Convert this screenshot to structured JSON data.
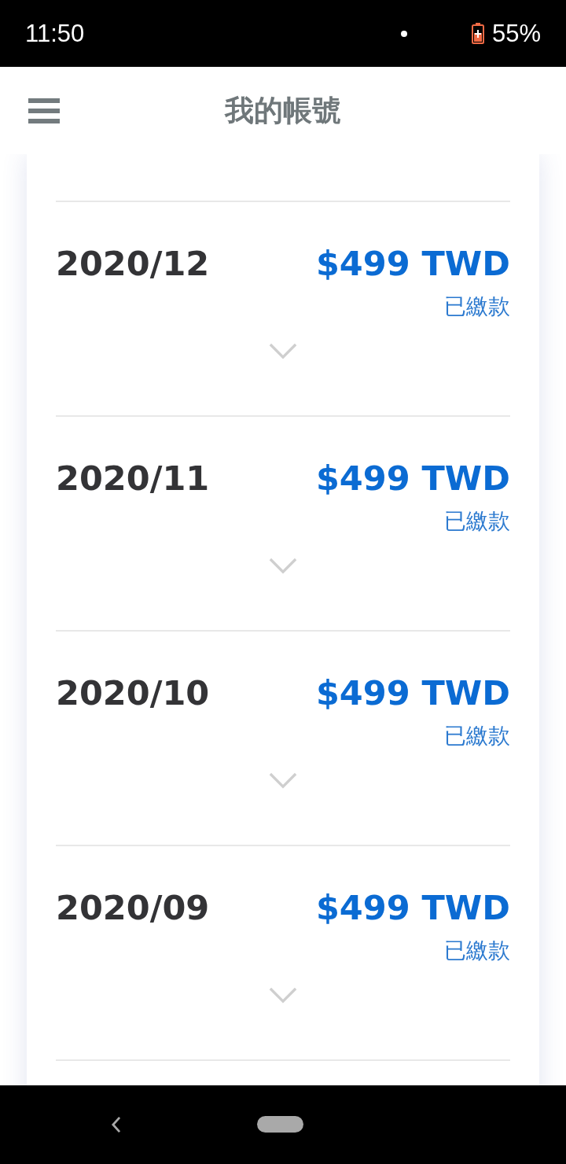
{
  "status_bar": {
    "time": "11:50",
    "battery": "55%"
  },
  "header": {
    "title": "我的帳號"
  },
  "bills": [
    {
      "month": "2020/12",
      "amount": "$499 TWD",
      "status": "已繳款",
      "expanded": false
    },
    {
      "month": "2020/11",
      "amount": "$499 TWD",
      "status": "已繳款",
      "expanded": false
    },
    {
      "month": "2020/10",
      "amount": "$499 TWD",
      "status": "已繳款",
      "expanded": false
    },
    {
      "month": "2020/09",
      "amount": "$499 TWD",
      "status": "已繳款",
      "expanded": false
    }
  ]
}
